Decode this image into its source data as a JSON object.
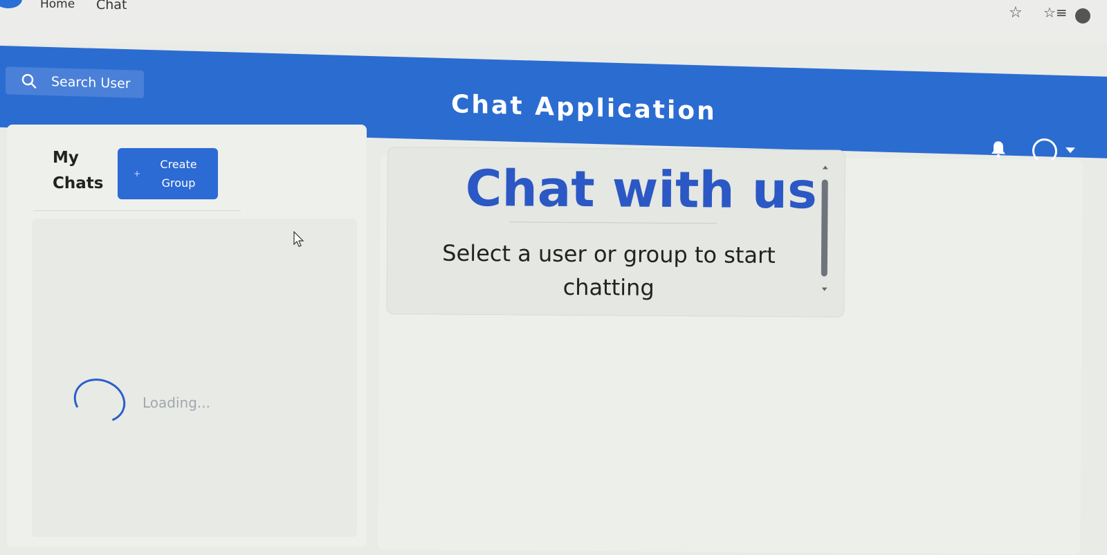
{
  "browser": {
    "bookmarks": [
      "Home",
      "Chat"
    ],
    "icons": [
      "star-icon",
      "favorites-icon",
      "profile-icon"
    ]
  },
  "header": {
    "search_label": "Search User",
    "title": "Chat Application",
    "icons": [
      "search-icon",
      "bell-icon",
      "chevron-down-icon"
    ]
  },
  "sidebar": {
    "title": "My Chats",
    "create_group_label": "Create Group",
    "create_group_icon": "plus-icon",
    "loading_text": "Loading..."
  },
  "main": {
    "welcome_title": "Chat with us",
    "welcome_subtitle": "Select a user or group to start chatting"
  },
  "colors": {
    "header": "#2b6cd1",
    "accent": "#2b58c4",
    "button": "#2c6ad4"
  }
}
